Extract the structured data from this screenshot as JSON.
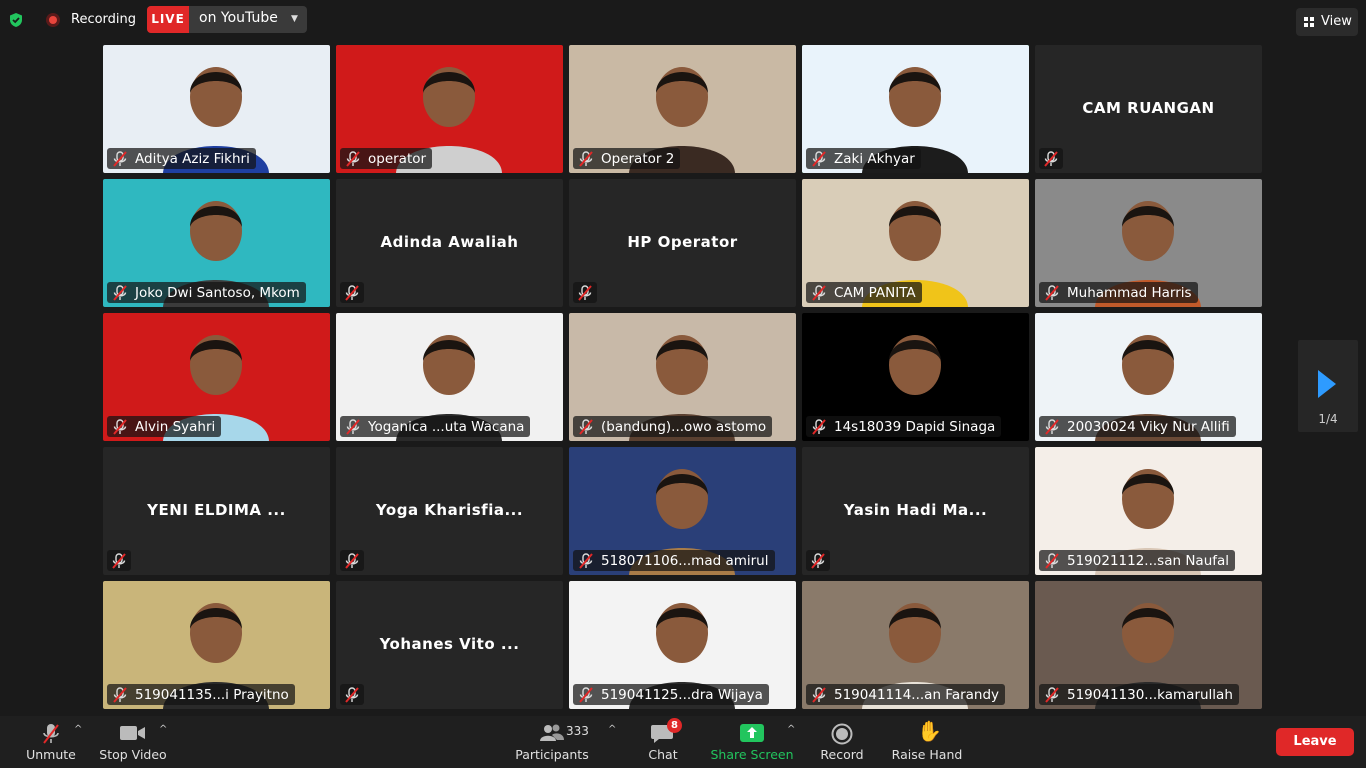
{
  "top_bar": {
    "recording_label": "Recording",
    "live_badge": "LIVE",
    "live_destination": "on YouTube",
    "view_label": "View"
  },
  "pager": {
    "page_label": "1/4"
  },
  "tiles": [
    {
      "name": "Aditya Aziz Fikhri",
      "label": "Aditya Aziz Fikhri",
      "type": "video",
      "bg": "#e8eef4",
      "person": "#1f3fa0"
    },
    {
      "name": "operator",
      "label": "operator",
      "type": "video",
      "bg": "#d01a1a",
      "person": "#cfcfcf"
    },
    {
      "name": "Operator 2",
      "label": "Operator 2",
      "type": "video",
      "bg": "#c9b9a4",
      "person": "#3a2a22"
    },
    {
      "name": "Zaki Akhyar",
      "label": "Zaki Akhyar",
      "type": "video",
      "bg": "#e9f3fb",
      "person": "#1c1c1c",
      "active": true
    },
    {
      "name": "CAM RUANGAN",
      "label": "",
      "type": "name"
    },
    {
      "name": "Joko Dwi Santoso, Mkom",
      "label": "Joko Dwi Santoso, Mkom",
      "type": "video",
      "bg": "#2fb8c0",
      "person": "#3b3b3b"
    },
    {
      "name": "Adinda Awaliah",
      "label": "",
      "type": "name"
    },
    {
      "name": "HP Operator",
      "label": "",
      "type": "name"
    },
    {
      "name": "CAM PANITA",
      "label": "CAM PANITA",
      "type": "video",
      "bg": "#d9cdb8",
      "person": "#f0c419"
    },
    {
      "name": "Muhammad Harris",
      "label": "Muhammad Harris",
      "type": "video",
      "bg": "#8a8a8a",
      "person": "#c15a2a"
    },
    {
      "name": "Alvin Syahri",
      "label": "Alvin Syahri",
      "type": "video",
      "bg": "#d01a1a",
      "person": "#a7d7ea"
    },
    {
      "name": "Yoganica ...uta Wacana",
      "label": "Yoganica ...uta Wacana",
      "type": "video",
      "bg": "#f1f1f1",
      "person": "#2a2a2a"
    },
    {
      "name": "(bandung)...owo astomo",
      "label": "(bandung)...owo astomo",
      "type": "video",
      "bg": "#c8b9a8",
      "person": "#5a4030"
    },
    {
      "name": "14s18039 Dapid Sinaga",
      "label": "14s18039 Dapid Sinaga",
      "type": "video",
      "bg": "#000000",
      "person": "#000000"
    },
    {
      "name": "20030024 Viky Nur Allifi",
      "label": "20030024 Viky Nur Allifi",
      "type": "video",
      "bg": "#eef3f7",
      "person": "#6b4a36"
    },
    {
      "name": "YENI ELDIMA ...",
      "label": "",
      "type": "name"
    },
    {
      "name": "Yoga Kharisfia...",
      "label": "",
      "type": "name"
    },
    {
      "name": "518071106...mad amirul",
      "label": "518071106...mad amirul",
      "type": "video",
      "bg": "#2a3f78",
      "person": "#a97c48"
    },
    {
      "name": "Yasin Hadi Ma...",
      "label": "",
      "type": "name"
    },
    {
      "name": "519021112...san Naufal",
      "label": "519021112...san Naufal",
      "type": "video",
      "bg": "#f4eee8",
      "person": "#d9c7b6"
    },
    {
      "name": "519041135...i Prayitno",
      "label": "519041135...i Prayitno",
      "type": "video",
      "bg": "#c9b57a",
      "person": "#2a2a2a"
    },
    {
      "name": "Yohanes Vito ...",
      "label": "",
      "type": "name"
    },
    {
      "name": "519041125...dra Wijaya",
      "label": "519041125...dra Wijaya",
      "type": "video",
      "bg": "#f3f3f3",
      "person": "#2a2a2a"
    },
    {
      "name": "519041114...an Farandy",
      "label": "519041114...an Farandy",
      "type": "video",
      "bg": "#8a7a6a",
      "person": "#e8e2d8"
    },
    {
      "name": "519041130...kamarullah",
      "label": "519041130...kamarullah",
      "type": "video",
      "bg": "#6a5a50",
      "person": "#2a2a2a"
    }
  ],
  "toolbar": {
    "unmute_label": "Unmute",
    "stop_video_label": "Stop Video",
    "participants_count": "333",
    "participants_label": "Participants",
    "chat_badge": "8",
    "chat_label": "Chat",
    "share_label": "Share Screen",
    "record_label": "Record",
    "raise_hand_label": "Raise Hand",
    "leave_label": "Leave"
  },
  "colors": {
    "background": "#1a1a1a",
    "tile": "#262626",
    "active_speaker": "#23c65a",
    "live_red": "#e02828",
    "share_green": "#22c55e",
    "pager_blue": "#2e9bff"
  }
}
